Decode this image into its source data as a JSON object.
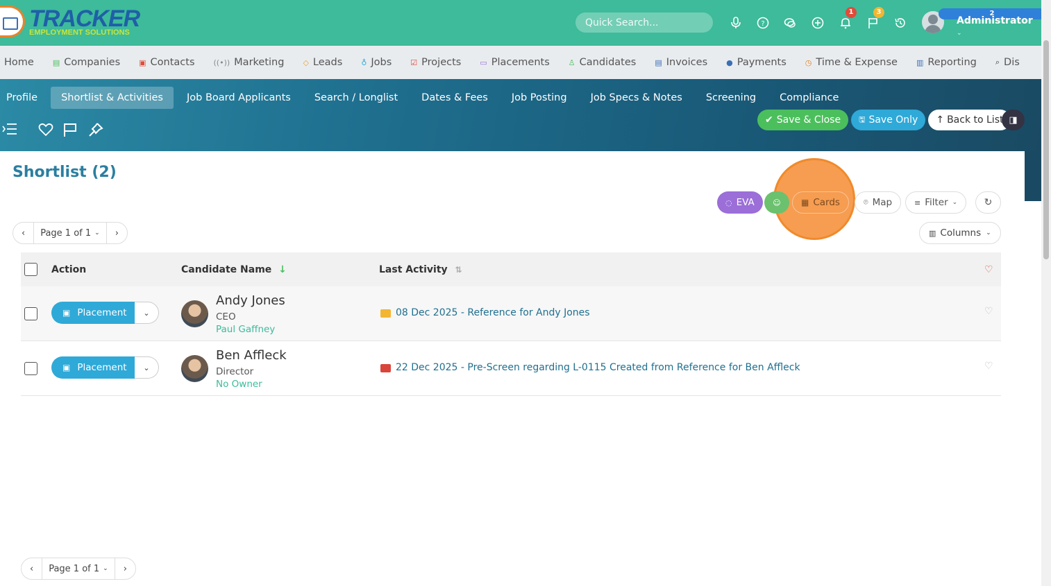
{
  "topbar": {
    "logo_title": "TRACKER",
    "logo_sub": "EMPLOYMENT SOLUTIONS",
    "search_placeholder": "Quick Search...",
    "icons": [
      "microphone-icon",
      "help-icon",
      "chat-icon",
      "add-icon",
      "bell-icon",
      "flag-icon",
      "history-icon"
    ],
    "bell_badge": "1",
    "flag_badge": "3",
    "avatar_badge": "2",
    "user_name": "Administrator",
    "colors": {
      "bar": "#3dbb9a",
      "badge_red": "#e04b3a",
      "badge_yellow": "#f2b632",
      "badge_blue": "#2f80d8"
    }
  },
  "mainnav": {
    "items": [
      {
        "label": "Home",
        "icon": ""
      },
      {
        "label": "Companies",
        "icon": "building-icon",
        "color": "#4cbf5d"
      },
      {
        "label": "Contacts",
        "icon": "contact-icon",
        "color": "#e04b3a"
      },
      {
        "label": "Marketing",
        "icon": "broadcast-icon",
        "color": "#888"
      },
      {
        "label": "Leads",
        "icon": "lead-icon",
        "color": "#e8a32a"
      },
      {
        "label": "Jobs",
        "icon": "trophy-icon",
        "color": "#2fa9d8"
      },
      {
        "label": "Projects",
        "icon": "check-square-icon",
        "color": "#e04b3a"
      },
      {
        "label": "Placements",
        "icon": "briefcase-icon",
        "color": "#9b6ed8"
      },
      {
        "label": "Candidates",
        "icon": "person-icon",
        "color": "#4cbf5d"
      },
      {
        "label": "Invoices",
        "icon": "invoice-icon",
        "color": "#3a6fb5"
      },
      {
        "label": "Payments",
        "icon": "payment-icon",
        "color": "#3a6fb5"
      },
      {
        "label": "Time & Expense",
        "icon": "clock-icon",
        "color": "#e8832a"
      },
      {
        "label": "Reporting",
        "icon": "chart-icon",
        "color": "#3a6fb5"
      },
      {
        "label": "Dis",
        "icon": "search-icon",
        "color": "#333"
      }
    ]
  },
  "subtabs": {
    "items": [
      "Profile",
      "Shortlist & Activities",
      "Job Board Applicants",
      "Search / Longlist",
      "Dates & Fees",
      "Job Posting",
      "Job Specs & Notes",
      "Screening",
      "Compliance"
    ],
    "active_index": 1
  },
  "toolbar": {
    "save_close": "Save & Close",
    "save_only": "Save Only",
    "back": "Back to List"
  },
  "content": {
    "title": "Shortlist (2)",
    "views": {
      "eva": "EVA",
      "cards": "Cards",
      "map": "Map",
      "filter": "Filter"
    },
    "pager_top": "Page 1 of 1",
    "pager_bottom": "Page 1 of 1",
    "columns": "Columns",
    "table": {
      "headers": {
        "action": "Action",
        "name": "Candidate Name",
        "activity": "Last Activity"
      },
      "rows": [
        {
          "action": "Placement",
          "name": "Andy Jones",
          "role": "CEO",
          "owner": "Paul Gaffney",
          "activity": "08 Dec 2025 - Reference for Andy Jones",
          "activity_color": "#f2b632"
        },
        {
          "action": "Placement",
          "name": "Ben Affleck",
          "role": "Director",
          "owner": "No Owner",
          "activity": "22 Dec 2025 - Pre-Screen regarding L-0115 Created from Reference for Ben Affleck",
          "activity_color": "#d9453a"
        }
      ]
    }
  }
}
